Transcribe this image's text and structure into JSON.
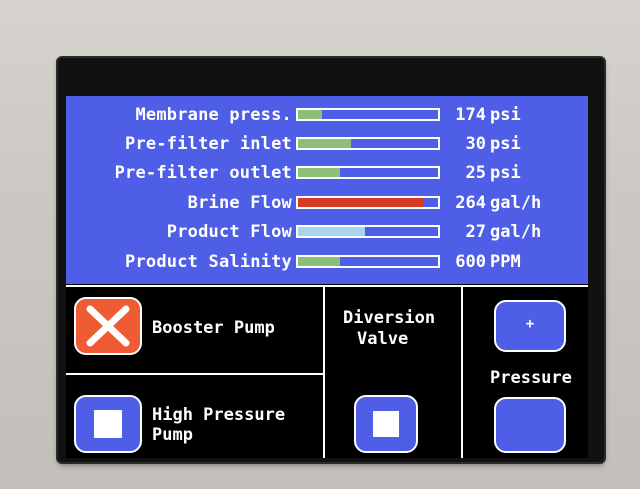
{
  "status_rows": [
    {
      "label": "Membrane press.",
      "value": "174",
      "unit": "psi",
      "fill_fraction": 0.17,
      "color": "#8cc07a"
    },
    {
      "label": "Pre-filter inlet",
      "value": "30",
      "unit": "psi",
      "fill_fraction": 0.38,
      "color": "#8cc07a"
    },
    {
      "label": "Pre-filter outlet",
      "value": "25",
      "unit": "psi",
      "fill_fraction": 0.3,
      "color": "#8cc07a"
    },
    {
      "label": "Brine Flow",
      "value": "264",
      "unit": "gal/h",
      "fill_fraction": 0.9,
      "color": "#d83a25"
    },
    {
      "label": "Product Flow",
      "value": "27",
      "unit": "gal/h",
      "fill_fraction": 0.48,
      "color": "#a9d5ec"
    },
    {
      "label": "Product Salinity",
      "value": "600",
      "unit": "PPM",
      "fill_fraction": 0.3,
      "color": "#8cc07a"
    }
  ],
  "controls": {
    "booster_pump": {
      "label": "Booster Pump",
      "state": "off"
    },
    "high_pressure_pump": {
      "label_line1": "High Pressure",
      "label_line2": "Pump"
    },
    "diversion_valve": {
      "label_line1": "Diversion",
      "label_line2": "Valve"
    },
    "pressure": {
      "label": "Pressure",
      "increase_symbol": "+"
    }
  },
  "colors": {
    "panel_blue": "#4f5ee6",
    "alert_red": "#ef5c33"
  }
}
